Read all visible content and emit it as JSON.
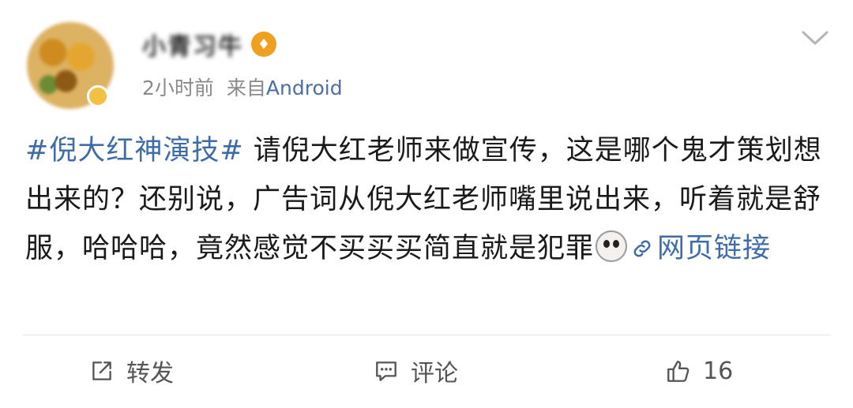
{
  "post": {
    "username": "小青习牛",
    "time": "2小时前",
    "source_prefix": "来自",
    "source_platform": "Android",
    "hashtag": "#倪大红神演技#",
    "body_text": " 请倪大红老师来做宣传，这是哪个鬼才策划想出来的？还别说，广告词从倪大红老师嘴里说出来，听着就是舒服，哈哈哈，竟然感觉不买买买简直就是犯罪",
    "link_label": "网页链接",
    "emoji": "emoji-face-icon"
  },
  "actions": {
    "repost_label": "转发",
    "comment_label": "评论",
    "like_count": "16"
  },
  "colors": {
    "link": "#3e6ca8",
    "meta": "#8a8a8a",
    "vip": "#f0a020"
  }
}
